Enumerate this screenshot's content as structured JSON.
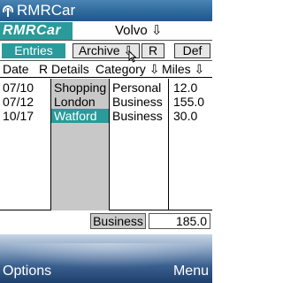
{
  "app": {
    "title": "RMRCar",
    "logo_text": "RMRCar"
  },
  "vehicle": {
    "selected": "Volvo ⇩"
  },
  "tabs": [
    {
      "label": "Entries",
      "active": true
    },
    {
      "label": "Archive ⇩",
      "active": false
    },
    {
      "label": "R",
      "active": false
    },
    {
      "label": "Def",
      "active": false
    }
  ],
  "table": {
    "headers": {
      "date": "Date",
      "r": "R",
      "details": "Details",
      "category": "Category ⇩",
      "miles": "Miles ⇩"
    },
    "rows": [
      {
        "date": "07/10",
        "details": "Shopping",
        "category": "Personal",
        "miles": "12.0",
        "selected": false
      },
      {
        "date": "07/12",
        "details": "London",
        "category": "Business",
        "miles": "155.0",
        "selected": false
      },
      {
        "date": "10/17",
        "details": "Watford",
        "category": "Business",
        "miles": "30.0",
        "selected": true
      }
    ]
  },
  "total": {
    "category": "Business",
    "value": "185.0"
  },
  "softkeys": {
    "left": "Options",
    "right": "Menu"
  },
  "colors": {
    "accent": "#2a9a9a",
    "titlebar": "#2f6a9c",
    "details_column": "#c8c8c8"
  }
}
